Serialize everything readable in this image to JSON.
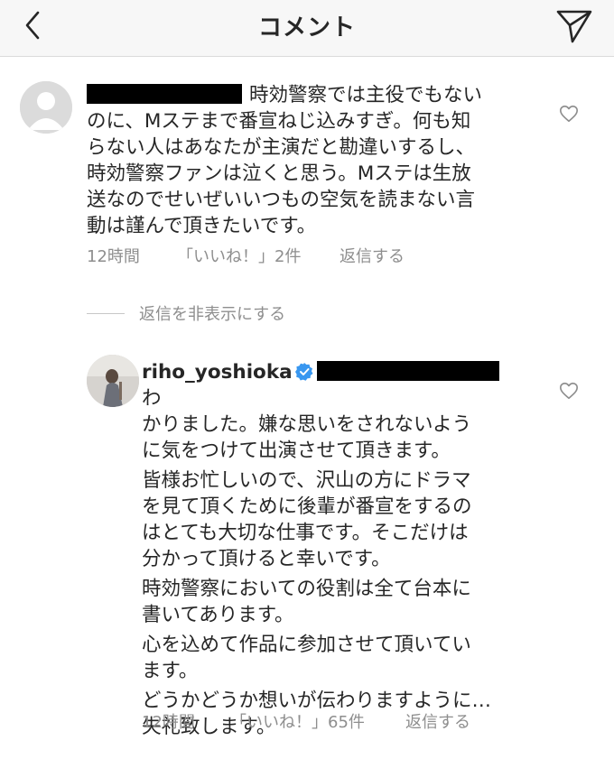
{
  "header": {
    "title": "コメント",
    "back_icon": "chevron-left-icon",
    "send_icon": "paper-plane-icon"
  },
  "comment1": {
    "text_l1": "時効警察では主役でもない",
    "text_l2": "のに、Mステまで番宣ねじ込みすぎ。何も知",
    "text_l3": "らない人はあなたが主演だと勘違いするし、",
    "text_l4": "時効警察ファンは泣くと思う。Mステは生放",
    "text_l5": "送なのでせいぜいいつもの空気を読まない言",
    "text_l6": "動は謹んで頂きたいです。",
    "time": "12時間",
    "likes": "「いいね！」2件",
    "reply": "返信する"
  },
  "hide_replies": "返信を非表示にする",
  "reply1": {
    "username": "riho_yoshioka",
    "text_l0": "わ",
    "text_l1": "かりました。嫌な思いをされないよう",
    "text_l2": "に気をつけて出演させて頂きます。",
    "text_l3": "皆様お忙しいので、沢山の方にドラマ",
    "text_l4": "を見て頂くために後輩が番宣をするの",
    "text_l5": "はとても大切な仕事です。そこだけは",
    "text_l6": "分かって頂けると幸いです。",
    "text_l7": "時効警察においての役割は全て台本に",
    "text_l8": "書いてあります。",
    "text_l9": "心を込めて作品に参加させて頂いてい",
    "text_l10": "ます。",
    "text_l11": "どうかどうか想いが伝わりますように…",
    "text_l12": "失礼致します。",
    "time": "12時間",
    "likes": "「いいね！」65件",
    "reply": "返信する"
  },
  "colors": {
    "text": "#262626",
    "meta": "#8e8e8e",
    "verified": "#3897f0",
    "header_bg": "#f7f7f7"
  }
}
